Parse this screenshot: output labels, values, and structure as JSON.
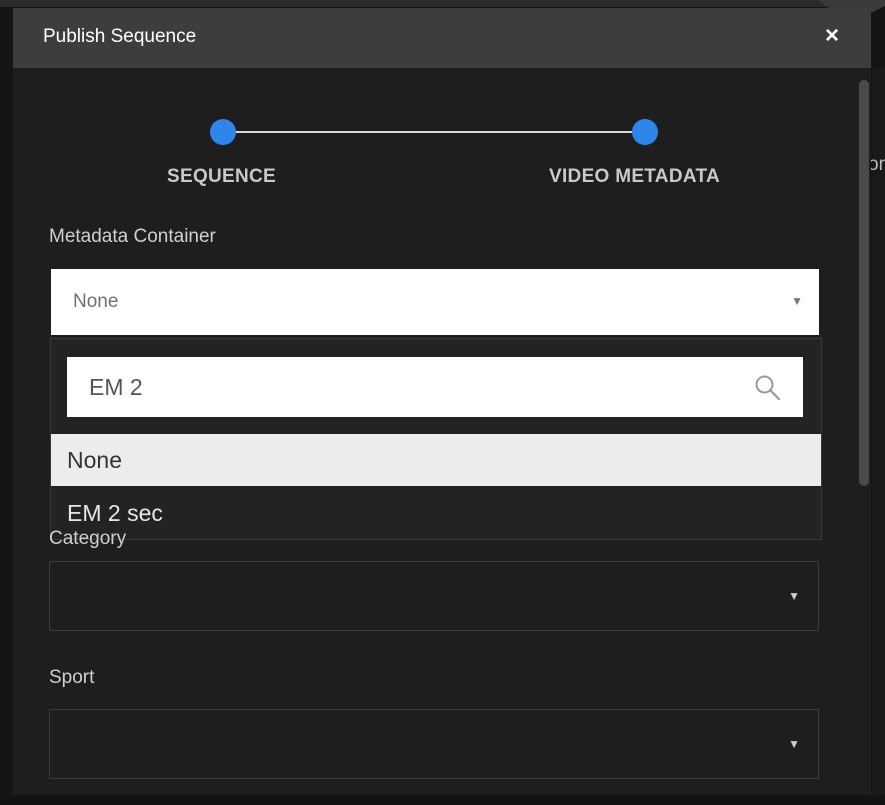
{
  "dialog": {
    "title": "Publish Sequence",
    "close_symbol": "×"
  },
  "stepper": {
    "steps": [
      {
        "label": "SEQUENCE"
      },
      {
        "label": "VIDEO METADATA"
      }
    ]
  },
  "form": {
    "metadata_container": {
      "label": "Metadata Container",
      "selected_value": "None",
      "search_value": "EM 2",
      "options": [
        {
          "label": "None"
        },
        {
          "label": "EM 2 sec"
        }
      ]
    },
    "category": {
      "label": "Category"
    },
    "sport": {
      "label": "Sport"
    }
  },
  "colors": {
    "accent": "#2f86ea",
    "header_bg": "#3d3d3d",
    "modal_bg": "#1e1e1e"
  },
  "icons": {
    "close": "close-icon",
    "search": "search-icon",
    "dropdown": "chevron-down-icon"
  }
}
